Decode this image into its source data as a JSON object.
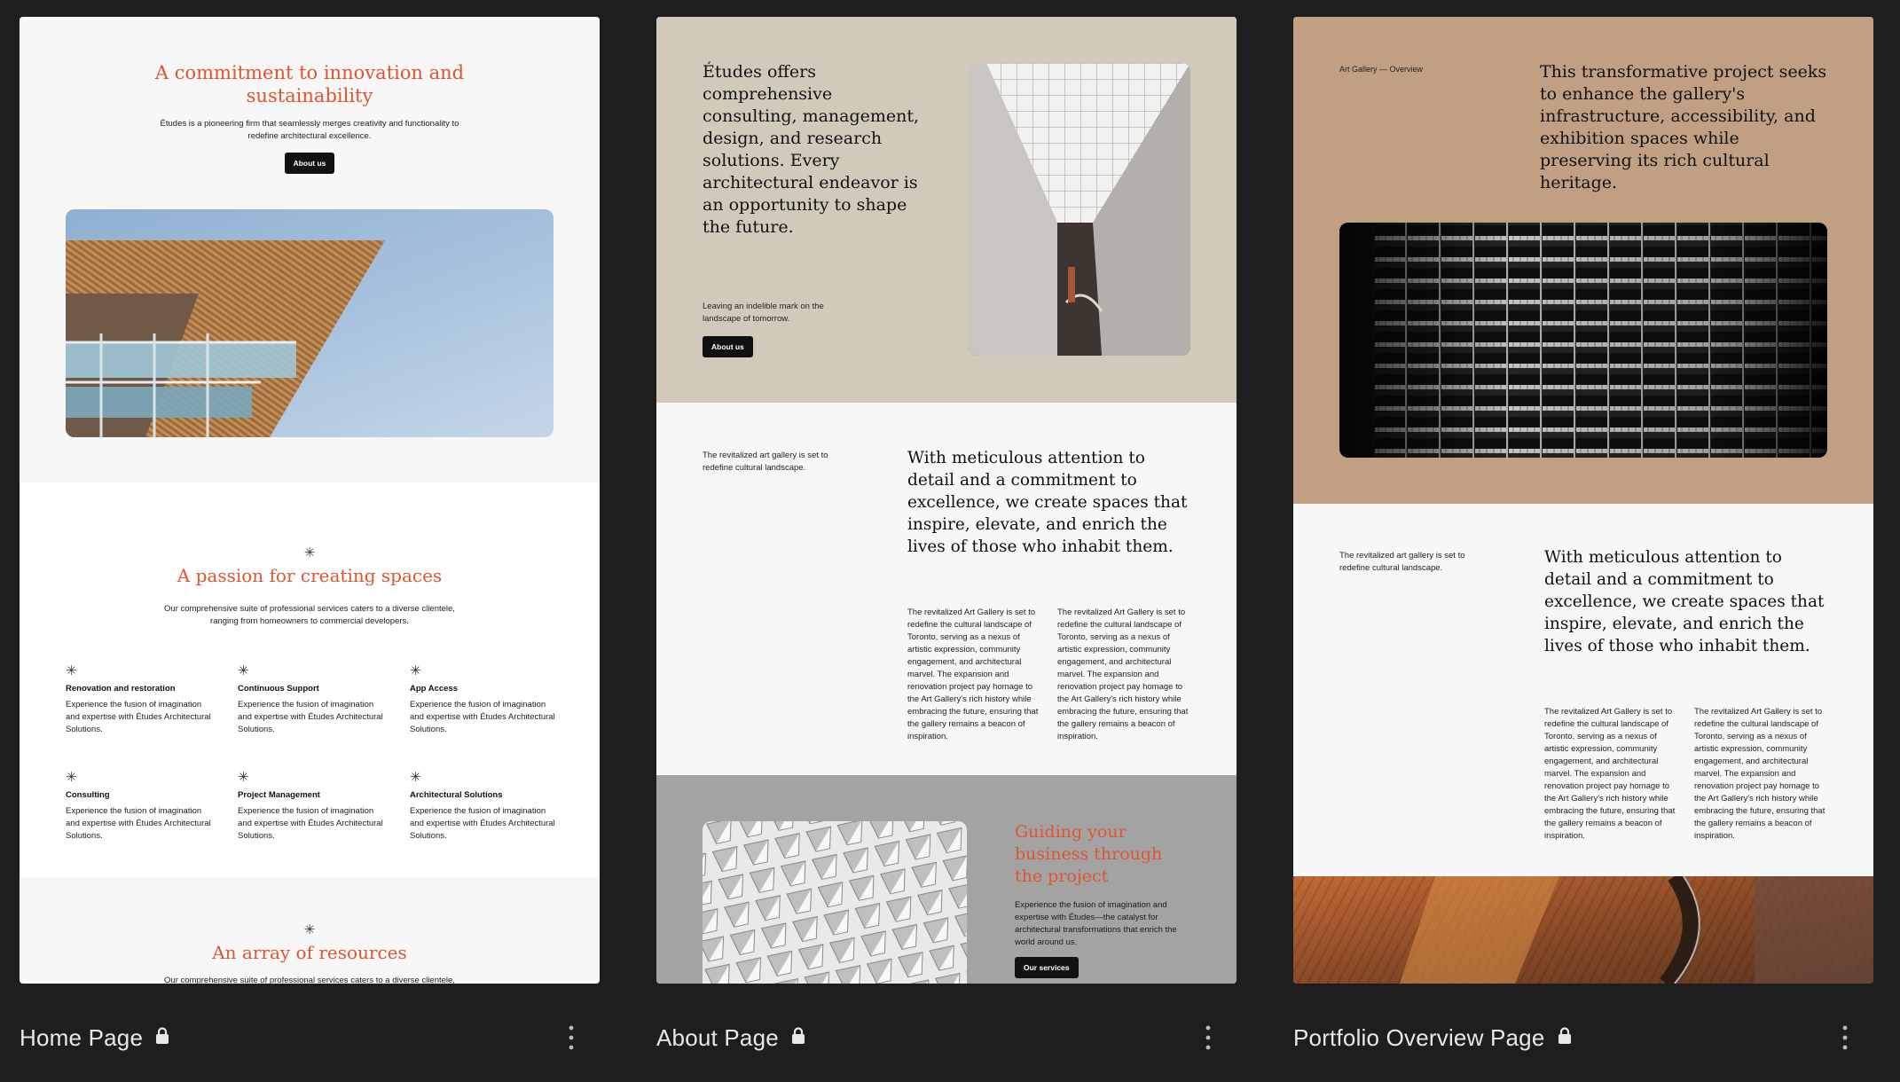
{
  "cards": [
    {
      "name": "Home Page",
      "content": {
        "hero_title": "A commitment to innovation and sustainability",
        "hero_desc": "Études is a pioneering firm that seamlessly merges creativity and functionality to redefine architectural excellence.",
        "hero_button": "About us",
        "passion_star": "✳",
        "passion_title": "A passion for creating spaces",
        "passion_desc": "Our comprehensive suite of professional services caters to a diverse clientele, ranging from homeowners to commercial developers.",
        "services": [
          {
            "title": "Renovation and restoration",
            "desc": "Experience the fusion of imagination and expertise with Études Architectural Solutions."
          },
          {
            "title": "Continuous Support",
            "desc": "Experience the fusion of imagination and expertise with Études Architectural Solutions."
          },
          {
            "title": "App Access",
            "desc": "Experience the fusion of imagination and expertise with Études Architectural Solutions."
          },
          {
            "title": "Consulting",
            "desc": "Experience the fusion of imagination and expertise with Études Architectural Solutions."
          },
          {
            "title": "Project Management",
            "desc": "Experience the fusion of imagination and expertise with Études Architectural Solutions."
          },
          {
            "title": "Architectural Solutions",
            "desc": "Experience the fusion of imagination and expertise with Études Architectural Solutions."
          }
        ],
        "resources_star": "✳",
        "resources_title": "An array of resources",
        "resources_desc": "Our comprehensive suite of professional services caters to a diverse clientele,"
      }
    },
    {
      "name": "About Page",
      "content": {
        "hero_text": "Études offers comprehensive consulting, management, design, and research solutions. Every architectural endeavor is an opportunity to shape the future.",
        "hero_sub": "Leaving an indelible mark on the landscape of tomorrow.",
        "hero_button": "About us",
        "side_note": "The revitalized art gallery is set to redefine cultural landscape.",
        "big_quote": "With meticulous attention to detail and a commitment to excellence, we create spaces that inspire, elevate, and enrich the lives of those who inhabit them.",
        "col1": "The revitalized Art Gallery is set to redefine the cultural landscape of Toronto, serving as a nexus of artistic expression, community engagement, and architectural marvel. The expansion and renovation project pay homage to the Art Gallery's rich history while embracing the future, ensuring that the gallery remains a beacon of inspiration.",
        "col2": "The revitalized Art Gallery is set to redefine the cultural landscape of Toronto, serving as a nexus of artistic expression, community engagement, and architectural marvel. The expansion and renovation project pay homage to the Art Gallery's rich history while embracing the future, ensuring that the gallery remains a beacon of inspiration.",
        "guide_title": "Guiding your business through the project",
        "guide_desc": "Experience the fusion of imagination and expertise with Études—the catalyst for architectural transformations that enrich the world around us.",
        "guide_button": "Our services"
      }
    },
    {
      "name": "Portfolio Overview Page",
      "content": {
        "breadcrumb": "Art Gallery — Overview",
        "hero_text": "This transformative project seeks to enhance the gallery's infrastructure, accessibility, and exhibition spaces while preserving its rich cultural heritage.",
        "side_note": "The revitalized art gallery is set to redefine cultural landscape.",
        "big_quote": "With meticulous attention to detail and a commitment to excellence, we create spaces that inspire, elevate, and enrich the lives of those who inhabit them.",
        "col1": "The revitalized Art Gallery is set to redefine the cultural landscape of Toronto, serving as a nexus of artistic expression, community engagement, and architectural marvel. The expansion and renovation project pay homage to the Art Gallery's rich history while embracing the future, ensuring that the gallery remains a beacon of inspiration.",
        "col2": "The revitalized Art Gallery is set to redefine the cultural landscape of Toronto, serving as a nexus of artistic expression, community engagement, and architectural marvel. The expansion and renovation project pay homage to the Art Gallery's rich history while embracing the future, ensuring that the gallery remains a beacon of inspiration."
      }
    }
  ],
  "icons": {
    "lock": "lock-icon",
    "more": "more-vertical-icon"
  },
  "colors": {
    "accent": "#e0552c",
    "background": "#1e1e1e",
    "about_hero": "#d1cabb",
    "portfolio_hero": "#c19f82"
  }
}
